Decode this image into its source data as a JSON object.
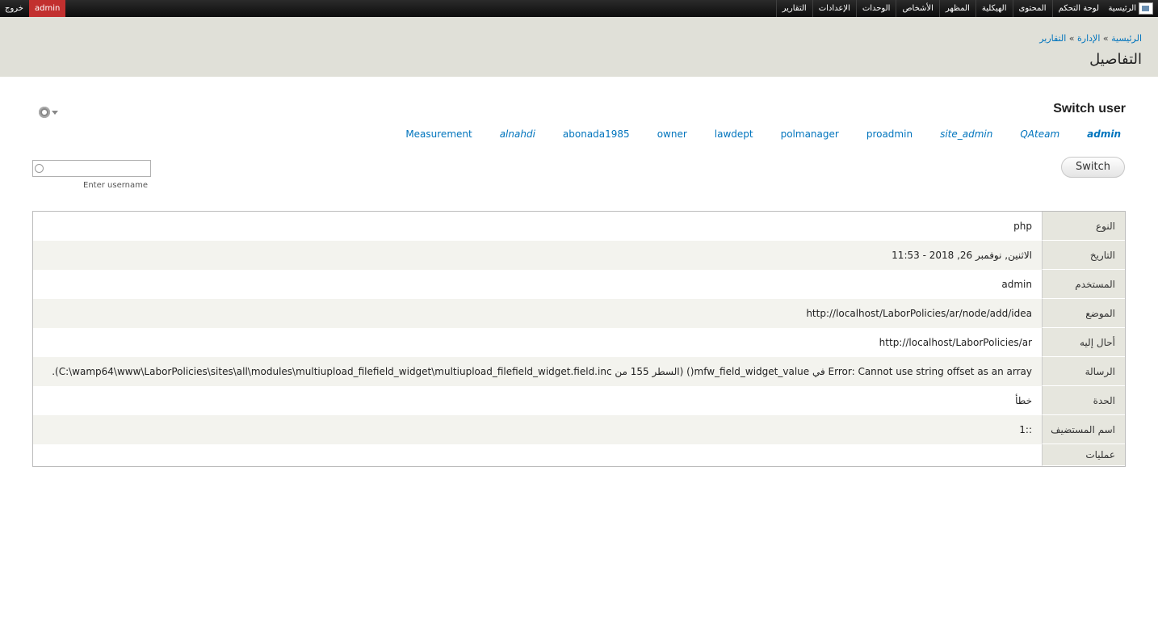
{
  "toolbar": {
    "home_label": "الرئيسية",
    "menu": [
      "لوحة التحكم",
      "المحتوى",
      "الهيكلية",
      "المظهر",
      "الأشخاص",
      "الوحدات",
      "الإعدادات",
      "التقارير"
    ],
    "user": "admin",
    "logout": "خروج"
  },
  "header": {
    "breadcrumb": [
      "الرئيسية",
      "الإدارة",
      "التقارير"
    ],
    "breadcrumb_sep": " » ",
    "title": "التفاصيل"
  },
  "switch_user": {
    "title": "Switch user",
    "users": [
      {
        "name": "admin",
        "style": "bold"
      },
      {
        "name": "QAteam",
        "style": "italic"
      },
      {
        "name": "site_admin",
        "style": "italic"
      },
      {
        "name": "proadmin",
        "style": "normal"
      },
      {
        "name": "polmanager",
        "style": "normal"
      },
      {
        "name": "lawdept",
        "style": "normal"
      },
      {
        "name": "owner",
        "style": "normal"
      },
      {
        "name": "abonada1985",
        "style": "normal"
      },
      {
        "name": "alnahdi",
        "style": "italic"
      },
      {
        "name": "Measurement",
        "style": "normal"
      }
    ],
    "button_label": "Switch",
    "input_help": "Enter username"
  },
  "details": [
    {
      "label": "النوع",
      "value": "php"
    },
    {
      "label": "التاريخ",
      "value": "الاثنين, نوفمبر 26, 2018 - 11:53"
    },
    {
      "label": "المستخدم",
      "value": "admin",
      "link": true
    },
    {
      "label": "الموضع",
      "value": "http://localhost/LaborPolicies/ar/node/add/idea",
      "link": true
    },
    {
      "label": "أحال إليه",
      "value": "http://localhost/LaborPolicies/ar",
      "link": true
    },
    {
      "label": "الرسالة",
      "value": "Error: Cannot use string offset as an array في mfw_field_widget_value() (السطر 155 من C:\\wamp64\\www\\LaborPolicies\\sites\\all\\modules\\multiupload_filefield_widget\\multiupload_filefield_widget.field.inc).",
      "msg": true
    },
    {
      "label": "الحدة",
      "value": "خطأ"
    },
    {
      "label": "اسم المستضيف",
      "value": "::1"
    },
    {
      "label": "عمليات",
      "value": ""
    }
  ],
  "colors": {
    "toolbar_bg": "#111111",
    "user_badge": "#c2302f",
    "header_bg": "#e0e0d8",
    "link": "#0074bd"
  }
}
